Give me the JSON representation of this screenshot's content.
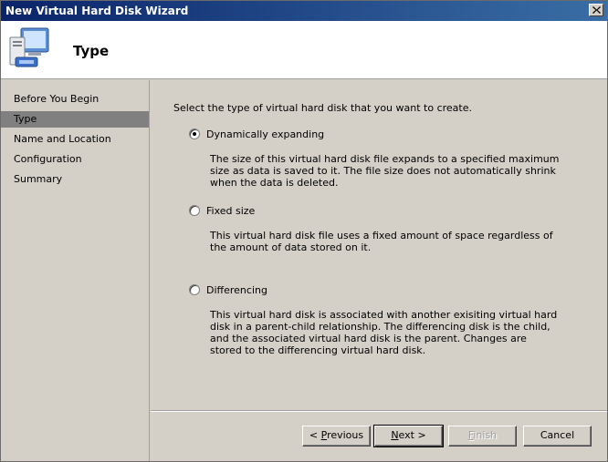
{
  "window": {
    "title": "New Virtual Hard Disk Wizard"
  },
  "header": {
    "page_title": "Type"
  },
  "sidebar": {
    "items": [
      {
        "label": "Before You Begin",
        "active": false
      },
      {
        "label": "Type",
        "active": true
      },
      {
        "label": "Name and Location",
        "active": false
      },
      {
        "label": "Configuration",
        "active": false
      },
      {
        "label": "Summary",
        "active": false
      }
    ]
  },
  "main": {
    "intro": "Select the type of virtual hard disk that you want to create.",
    "options": [
      {
        "label": "Dynamically expanding",
        "selected": true,
        "description": "The size of this virtual hard disk file expands to a specified maximum size as data is saved to it. The file size does not automatically shrink when the data is deleted."
      },
      {
        "label": "Fixed size",
        "selected": false,
        "description": "This virtual hard disk file uses a fixed amount of space regardless of the amount of data stored on it."
      },
      {
        "label": "Differencing",
        "selected": false,
        "description": "This virtual hard disk is associated with another exisiting virtual hard disk in a parent-child relationship. The differencing disk is the child, and the associated virtual hard disk is the parent. Changes are stored to the differencing virtual hard disk."
      }
    ]
  },
  "buttons": {
    "previous_mnemonic": "< ",
    "previous_key": "P",
    "previous_rest": "revious",
    "next_key": "N",
    "next_rest": "ext >",
    "finish_key": "F",
    "finish_rest": "inish",
    "cancel": "Cancel"
  },
  "icons": {
    "app": "monitor-disk-icon",
    "close": "close-icon"
  },
  "colors": {
    "titlebar_start": "#0a246a",
    "titlebar_end": "#3a6ea5",
    "selected_step": "#808080"
  }
}
